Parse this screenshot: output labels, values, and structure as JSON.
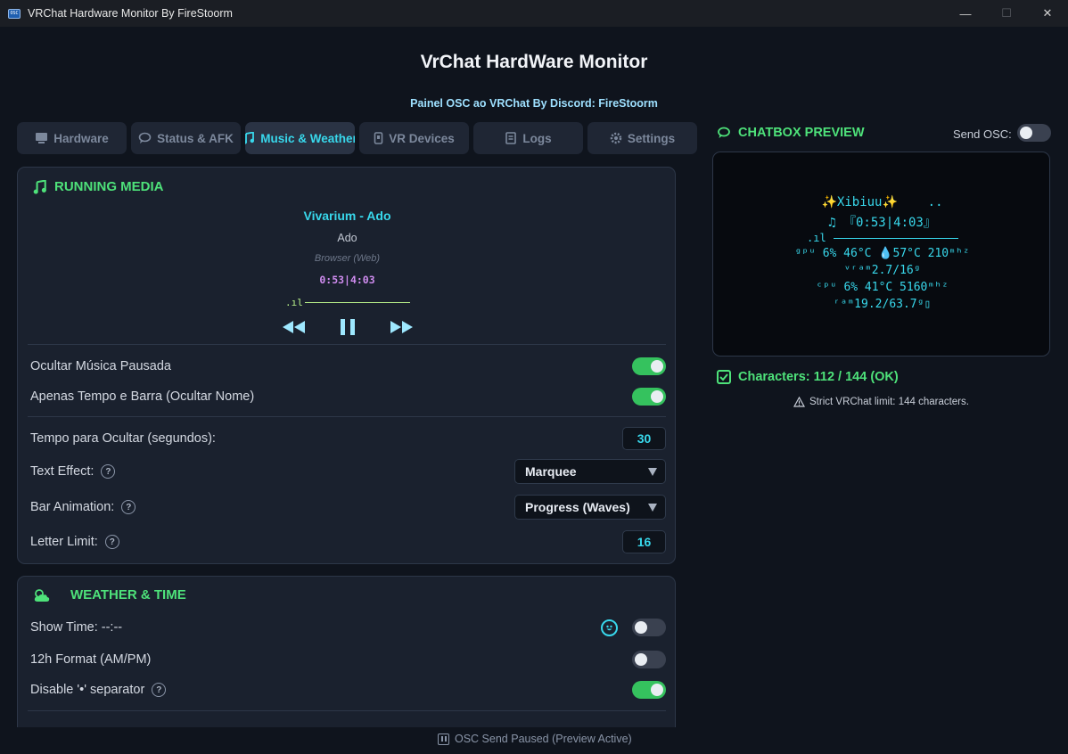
{
  "window": {
    "title": "VRChat Hardware Monitor By FireStoorm",
    "icon_text": "OSC",
    "minimize": "—",
    "maximize": "☐",
    "close": "✕"
  },
  "header": {
    "title": "VrChat HardWare Monitor",
    "subtitle": "Painel OSC ao VRChat By Discord: FireStoorm"
  },
  "tabs": [
    {
      "label": "Hardware",
      "icon": "monitor-icon",
      "active": false
    },
    {
      "label": "Status & AFK",
      "icon": "chat-bubble-icon",
      "active": false
    },
    {
      "label": "Music & Weather",
      "icon": "music-note-icon",
      "active": true
    },
    {
      "label": "VR Devices",
      "icon": "vr-device-icon",
      "active": false
    },
    {
      "label": "Logs",
      "icon": "scroll-icon",
      "active": false
    },
    {
      "label": "Settings",
      "icon": "gear-icon",
      "active": false
    }
  ],
  "media": {
    "section_title": "RUNNING MEDIA",
    "track_title": "Vivarium - Ado",
    "artist": "Ado",
    "source": "Browser (Web)",
    "time": "0:53|4:03",
    "bar_prefix": ".ıl"
  },
  "media_settings": {
    "hide_paused": {
      "label": "Ocultar Música Pausada",
      "on": true
    },
    "time_and_bar_only": {
      "label": "Apenas Tempo e Barra (Ocultar Nome)",
      "on": true
    },
    "hide_time": {
      "label": "Tempo para Ocultar (segundos):",
      "value": "30"
    },
    "text_effect": {
      "label": "Text Effect:",
      "value": "Marquee"
    },
    "bar_animation": {
      "label": "Bar Animation:",
      "value": "Progress (Waves)"
    },
    "letter_limit": {
      "label": "Letter Limit:",
      "value": "16"
    }
  },
  "weather": {
    "section_title": "WEATHER & TIME",
    "show_time": {
      "label": "Show Time: --:--",
      "on": false
    },
    "format_12h": {
      "label": "12h Format (AM/PM)",
      "on": false
    },
    "disable_separator": {
      "label": "Disable '•' separator",
      "on": true
    }
  },
  "preview": {
    "title": "CHATBOX PREVIEW",
    "send_osc_label": "Send OSC:",
    "send_osc_on": false,
    "lines": [
      "✨Xibiuu✨    ..",
      "♫ 『0:53|4:03』",
      ".ıl",
      "ᵍᵖᵘ 6% 46°C 💧57°C 210ᵐʰᶻ",
      "ᵛʳᵃᵐ2.7/16ᵍ",
      "ᶜᵖᵘ 6% 41°C 5160ᵐʰᶻ",
      "ʳᵃᵐ19.2/63.7ᵍ▯"
    ]
  },
  "characters": {
    "text": "Characters: 112 / 144 (OK)",
    "strict_note": "Strict VRChat limit: 144 characters."
  },
  "footer": {
    "status": "OSC Send Paused (Preview Active)"
  },
  "colors": {
    "accent_cyan": "#38d8ec",
    "accent_green": "#4ee27a",
    "toggle_on": "#35c25e",
    "background": "#0f141d",
    "panel": "#1a212e"
  }
}
